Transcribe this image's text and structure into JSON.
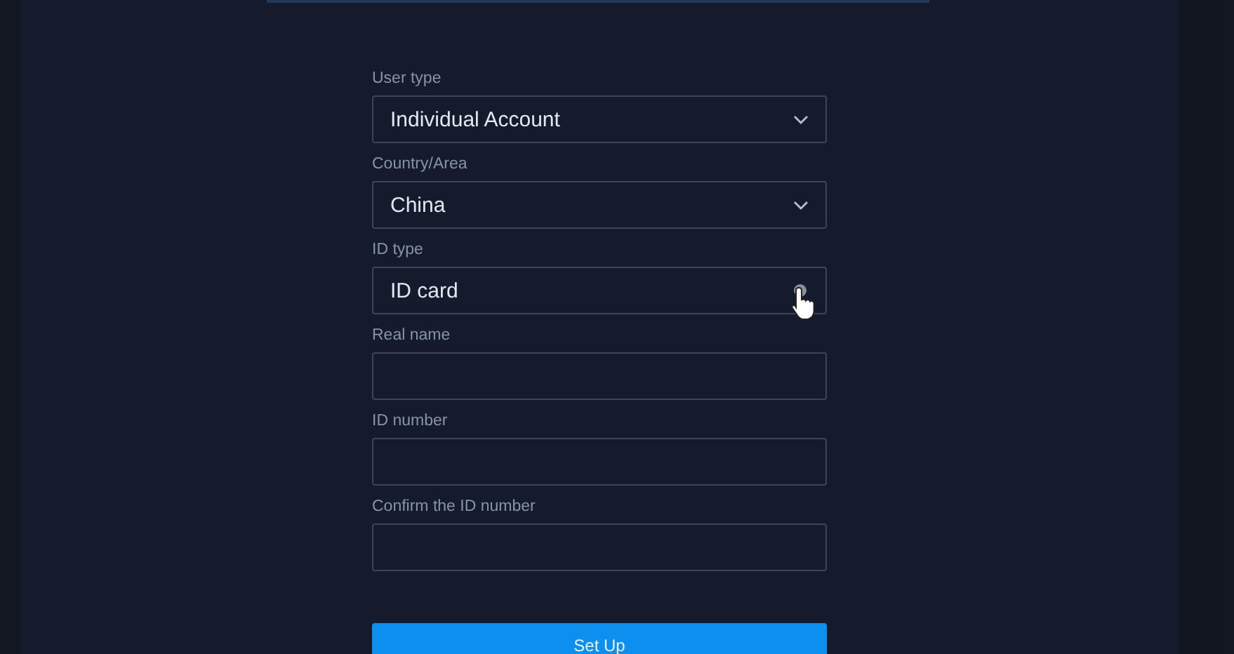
{
  "form": {
    "fields": [
      {
        "kind": "select",
        "label": "User type",
        "value": "Individual Account",
        "hovered": false
      },
      {
        "kind": "select",
        "label": "Country/Area",
        "value": "China",
        "hovered": false
      },
      {
        "kind": "select",
        "label": "ID type",
        "value": "ID card",
        "hovered": true
      },
      {
        "kind": "text",
        "label": "Real name"
      },
      {
        "kind": "text",
        "label": "ID number"
      },
      {
        "kind": "text",
        "label": "Confirm the ID number"
      }
    ],
    "submit": "Set Up"
  }
}
